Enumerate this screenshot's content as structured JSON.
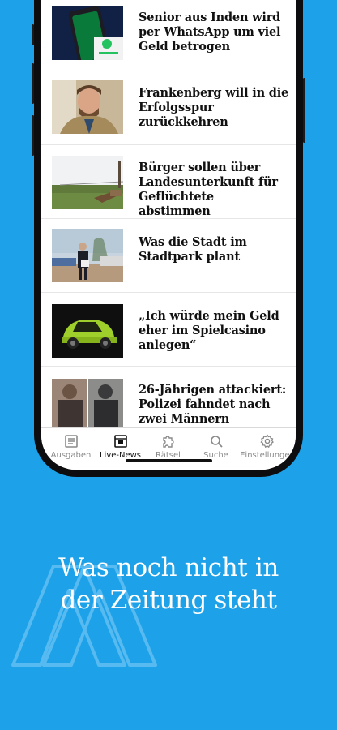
{
  "articles": [
    {
      "headline": "Senior aus Inden wird per WhatsApp um viel Geld betrogen",
      "image": "whatsapp-phone-photo"
    },
    {
      "headline": "Frankenberg will in die Erfolgsspur zurückkehren",
      "image": "man-portrait-photo"
    },
    {
      "headline": "Bürger sollen über Landesunterkunft für Geflüchtete abstimmen",
      "image": "field-photo"
    },
    {
      "headline": "Was die Stadt im Stadtpark plant",
      "image": "park-man-photo"
    },
    {
      "headline": "„Ich würde mein Geld eher im Spielcasino anlegen“",
      "image": "green-car-photo"
    },
    {
      "headline": "26-Jährigen attackiert: Polizei fahndet nach zwei Männern",
      "image": "suspects-photo"
    }
  ],
  "tabbar": {
    "tabs": [
      {
        "label": "Ausgaben",
        "icon": "newspaper-icon"
      },
      {
        "label": "Live-News",
        "icon": "live-news-icon"
      },
      {
        "label": "Rätsel",
        "icon": "puzzle-icon"
      },
      {
        "label": "Suche",
        "icon": "search-icon"
      },
      {
        "label": "Einstellungen",
        "icon": "gear-icon"
      }
    ],
    "active": "Live-News"
  },
  "promo": {
    "line1": "Was noch nicht in",
    "line2": "der Zeitung steht"
  },
  "colors": {
    "background": "#1da1e8",
    "text": "#111111",
    "tab_inactive": "#8a8a8a"
  }
}
